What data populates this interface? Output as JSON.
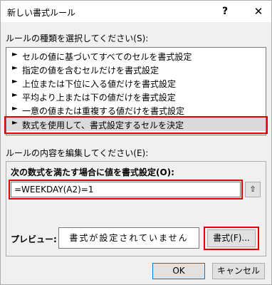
{
  "dialog": {
    "title": "新しい書式ルール",
    "help_label": "?",
    "close_label": "✕"
  },
  "rule_type": {
    "label": "ルールの種類を選択してください(S):",
    "items": [
      {
        "label": "セルの値に基づいてすべてのセルを書式設定"
      },
      {
        "label": "指定の値を含むセルだけを書式設定"
      },
      {
        "label": "上位または下位に入る値だけを書式設定"
      },
      {
        "label": "平均より上または下の値だけを書式設定"
      },
      {
        "label": "一意の値または重複する値だけを書式設定"
      },
      {
        "label": "数式を使用して、書式設定するセルを決定",
        "selected": true
      }
    ],
    "arrow": "►"
  },
  "rule_content": {
    "label": "ルールの内容を編集してください(E):",
    "formula_label": "次の数式を満たす場合に値を書式設定(O):",
    "formula_value": "=WEEKDAY(A2)=1",
    "collapse_icon": "⇧",
    "preview_label": "プレビュー:",
    "preview_text": "書式が設定されていません",
    "format_button": "書式(F)..."
  },
  "footer": {
    "ok": "OK",
    "cancel": "キャンセル"
  },
  "colors": {
    "highlight_border": "#e00000",
    "selected_bg": "#dadada",
    "dialog_bg": "#f0f0f0"
  }
}
